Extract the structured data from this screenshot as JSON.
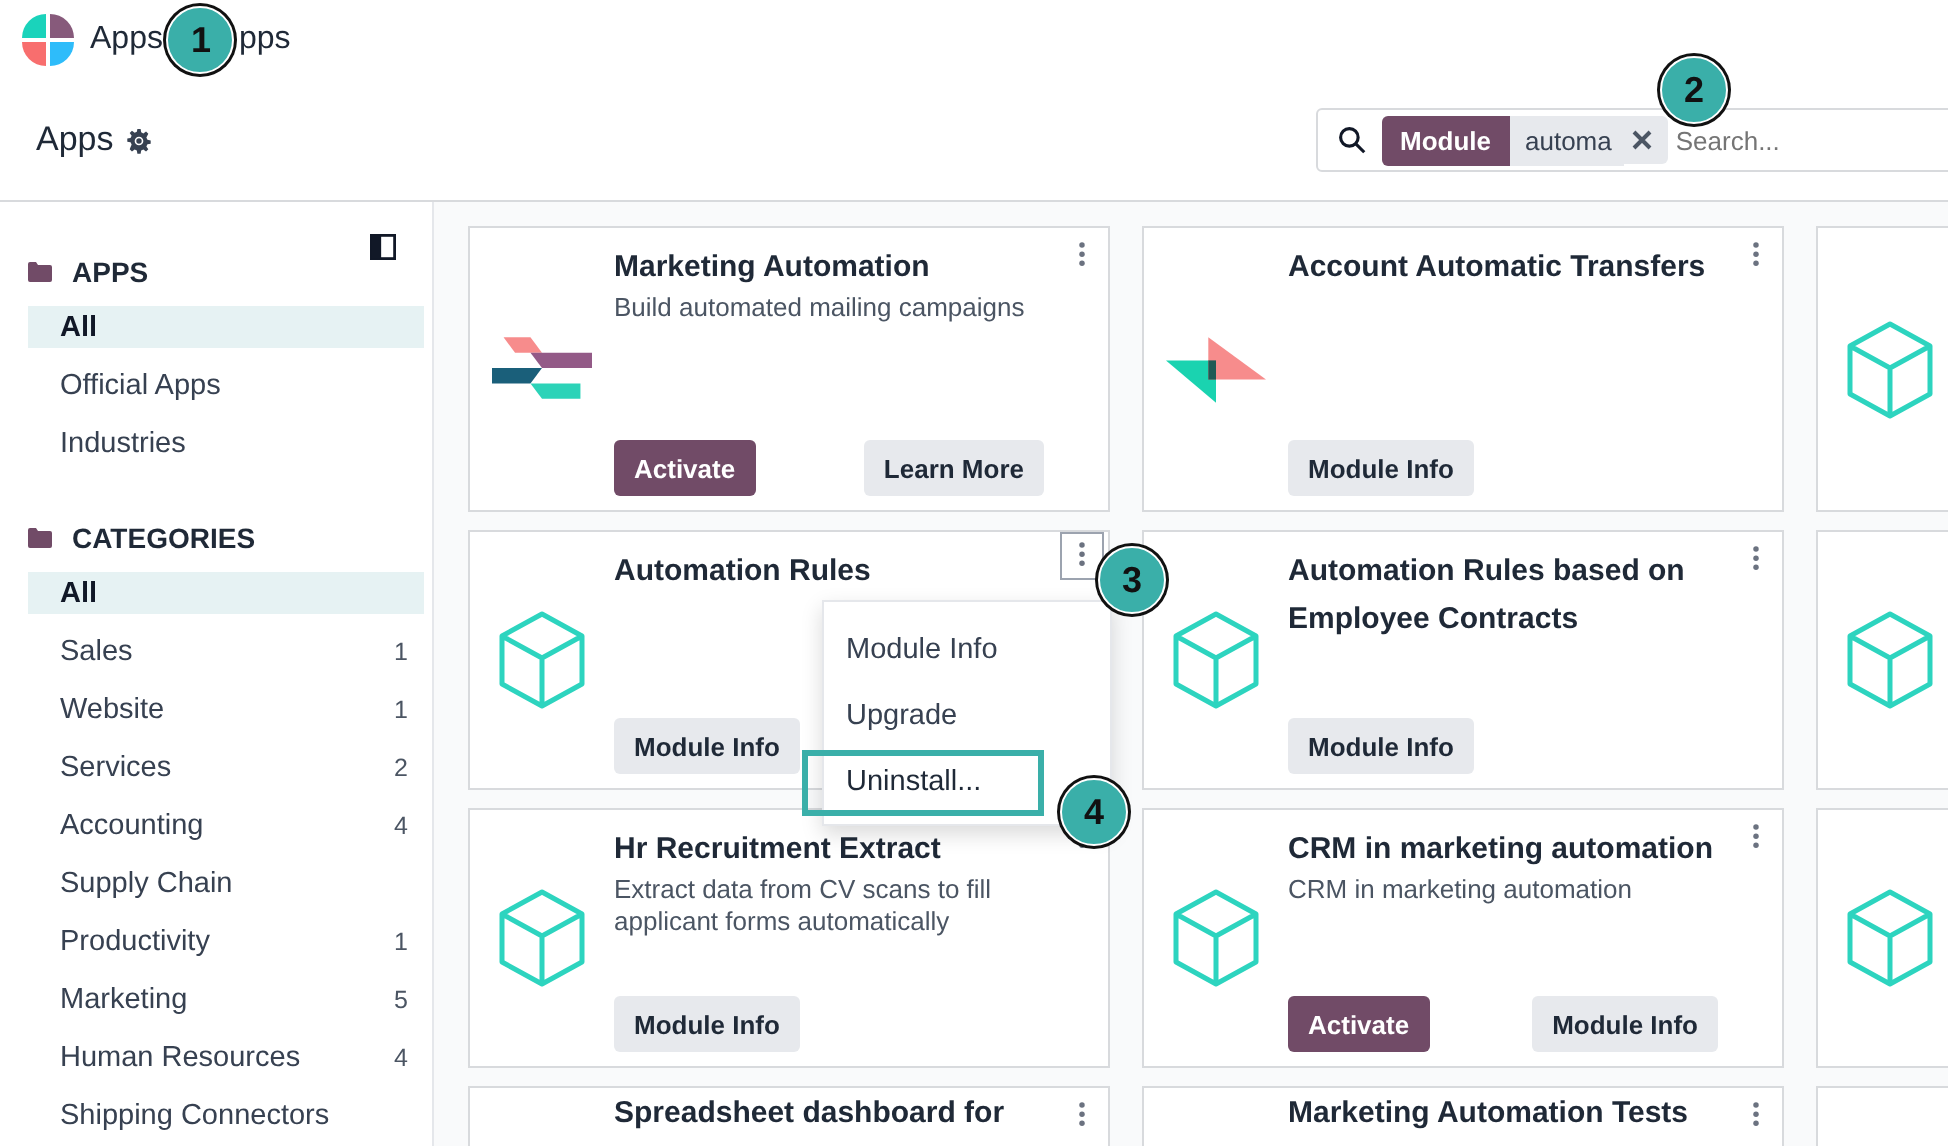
{
  "topbar": {
    "title": "Apps",
    "title_rest": "pps",
    "annotation": "1"
  },
  "control_panel": {
    "title": "Apps",
    "search": {
      "facet_label": "Module",
      "facet_value": "automa",
      "placeholder": "Search...",
      "annotation": "2"
    }
  },
  "sidebar": {
    "sections": [
      {
        "title": "APPS",
        "items": [
          {
            "label": "All",
            "selected": true
          },
          {
            "label": "Official Apps",
            "selected": false
          },
          {
            "label": "Industries",
            "selected": false
          }
        ]
      },
      {
        "title": "CATEGORIES",
        "items": [
          {
            "label": "All",
            "selected": true
          },
          {
            "label": "Sales",
            "count": "1",
            "selected": false
          },
          {
            "label": "Website",
            "count": "1",
            "selected": false
          },
          {
            "label": "Services",
            "count": "2",
            "selected": false
          },
          {
            "label": "Accounting",
            "count": "4",
            "selected": false
          },
          {
            "label": "Supply Chain",
            "selected": false
          },
          {
            "label": "Productivity",
            "count": "1",
            "selected": false
          },
          {
            "label": "Marketing",
            "count": "5",
            "selected": false
          },
          {
            "label": "Human Resources",
            "count": "4",
            "selected": false
          },
          {
            "label": "Shipping Connectors",
            "selected": false
          }
        ]
      }
    ]
  },
  "cards": [
    {
      "kind": "marketing",
      "menu_open": false,
      "title": "Marketing Automation",
      "description": "Build automated mailing campaigns",
      "buttons": [
        {
          "label": "Activate",
          "kind": "primary"
        },
        {
          "label": "Learn More",
          "kind": "secondary"
        }
      ]
    },
    {
      "kind": "transfers",
      "menu_open": false,
      "title": "Account Automatic Transfers",
      "buttons": [
        {
          "label": "Module Info",
          "kind": "secondary"
        }
      ]
    },
    {
      "kind": "cube"
    },
    {
      "kind": "cube",
      "title": "Automation Rules",
      "buttons": [
        {
          "label": "Module Info",
          "kind": "secondary"
        }
      ],
      "menu_open": true,
      "annotation": "3",
      "menu": [
        {
          "label": "Module Info",
          "highlighted": false
        },
        {
          "label": "Upgrade",
          "highlighted": false
        },
        {
          "label": "Uninstall...",
          "highlighted": true,
          "annotation": "4"
        }
      ]
    },
    {
      "kind": "cube",
      "menu_open": false,
      "title": "Automation Rules based on Employee Contracts",
      "buttons": [
        {
          "label": "Module Info",
          "kind": "secondary"
        }
      ]
    },
    {
      "kind": "cube"
    },
    {
      "kind": "cube",
      "menu_open": false,
      "title": "Hr Recruitment Extract",
      "description": "Extract data from CV scans to fill applicant forms automatically",
      "buttons": [
        {
          "label": "Module Info",
          "kind": "secondary"
        }
      ]
    },
    {
      "kind": "cube",
      "menu_open": false,
      "title": "CRM in marketing automation",
      "description": "CRM in marketing automation",
      "buttons": [
        {
          "label": "Activate",
          "kind": "primary"
        },
        {
          "label": "Module Info",
          "kind": "secondary"
        }
      ]
    },
    {
      "kind": "cube"
    },
    {
      "kind": "blank",
      "menu_open": false,
      "title": "Spreadsheet dashboard for"
    },
    {
      "kind": "blank",
      "menu_open": false,
      "title": "Marketing Automation Tests"
    },
    {
      "kind": "blank"
    }
  ]
}
